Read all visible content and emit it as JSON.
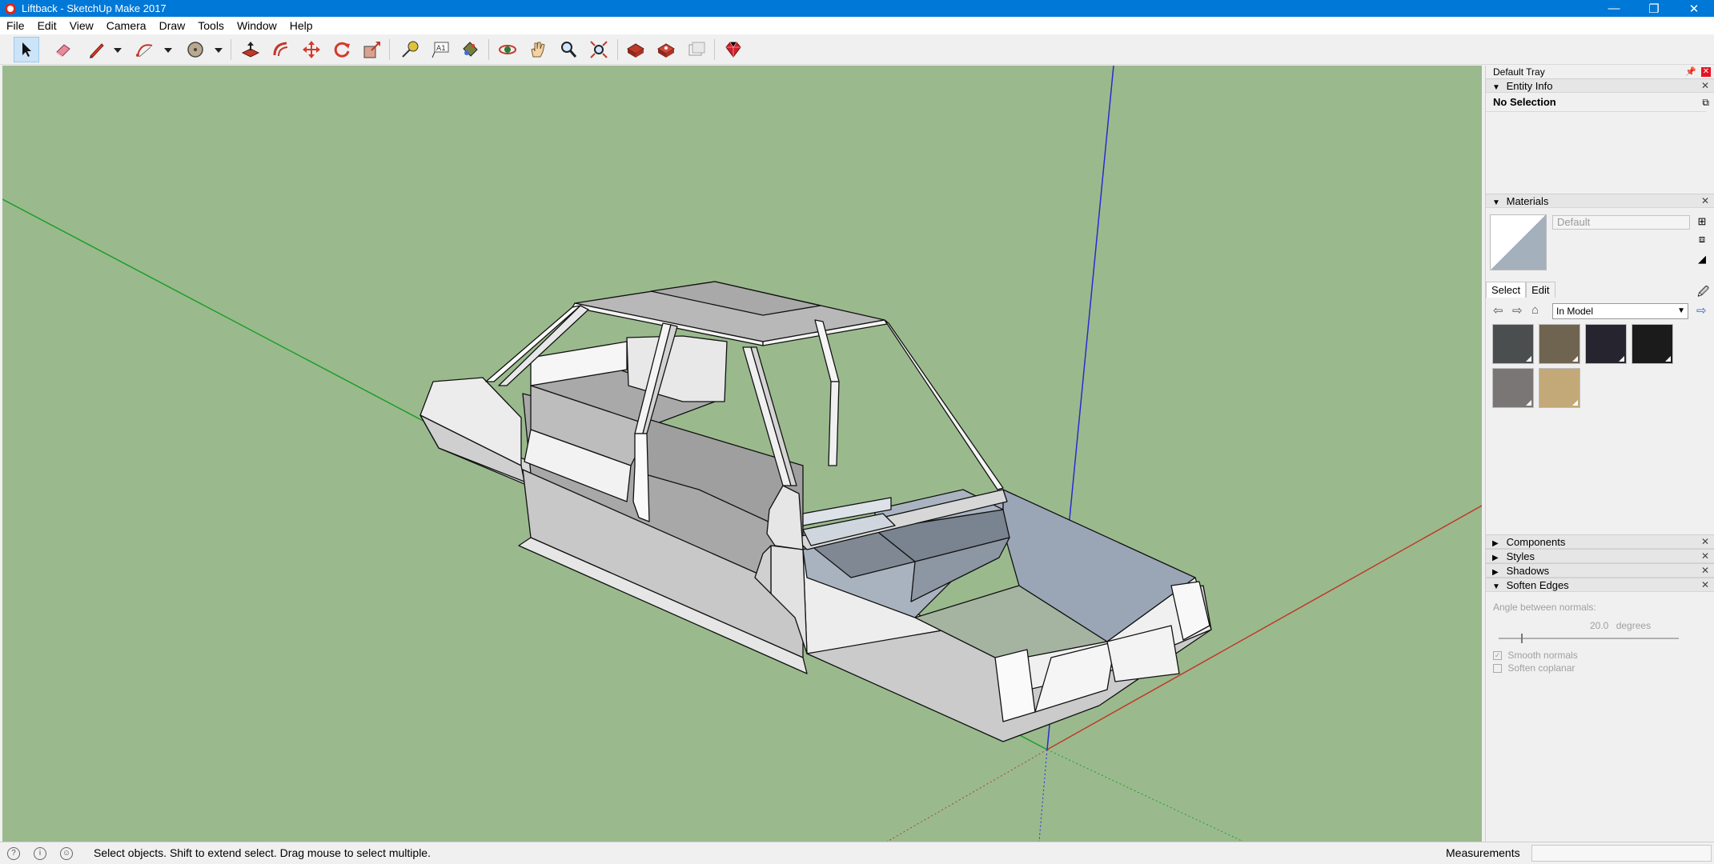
{
  "window": {
    "title": "Liftback - SketchUp Make 2017",
    "minimize_glyph": "—",
    "restore_glyph": "❐",
    "close_glyph": "✕"
  },
  "menu": [
    "File",
    "Edit",
    "View",
    "Camera",
    "Draw",
    "Tools",
    "Window",
    "Help"
  ],
  "toolbar": {
    "tools": [
      "select",
      "eraser",
      "line",
      "arc",
      "shapes",
      "push-pull",
      "offset",
      "move",
      "rotate",
      "scale",
      "tape-measure",
      "text",
      "paint-bucket",
      "orbit",
      "pan",
      "zoom",
      "zoom-extents",
      "3d-warehouse",
      "extension-warehouse",
      "send-to-layout",
      "extension-manager"
    ],
    "active_tool": "select"
  },
  "tray": {
    "title": "Default Tray",
    "entity_info": {
      "header": "Entity Info",
      "selection_label": "No Selection"
    },
    "materials": {
      "header": "Materials",
      "name_value": "Default",
      "tab_select": "Select",
      "tab_edit": "Edit",
      "collection": "In Model",
      "swatches": [
        "#4b4e4f",
        "#6f6450",
        "#26242f",
        "#1b1b1b",
        "#7a7676",
        "#c3a878"
      ]
    },
    "collapsed_panels": [
      "Components",
      "Styles",
      "Shadows"
    ],
    "soften_edges": {
      "header": "Soften Edges",
      "angle_label": "Angle between normals:",
      "angle_value": "20.0",
      "angle_unit": "degrees",
      "slider_fraction": 0.125,
      "smooth_normals_label": "Smooth normals",
      "smooth_normals_checked": true,
      "soften_coplanar_label": "Soften coplanar",
      "soften_coplanar_checked": false
    }
  },
  "statusbar": {
    "message": "Select objects. Shift to extend select. Drag mouse to select multiple.",
    "measurements_label": "Measurements",
    "measurements_value": ""
  },
  "colors": {
    "viewport_bg": "#9aba8d",
    "titlebar": "#0078d7",
    "axis_red": "#c0392b",
    "axis_green": "#1e9e2a",
    "axis_blue": "#2a2ad0"
  }
}
